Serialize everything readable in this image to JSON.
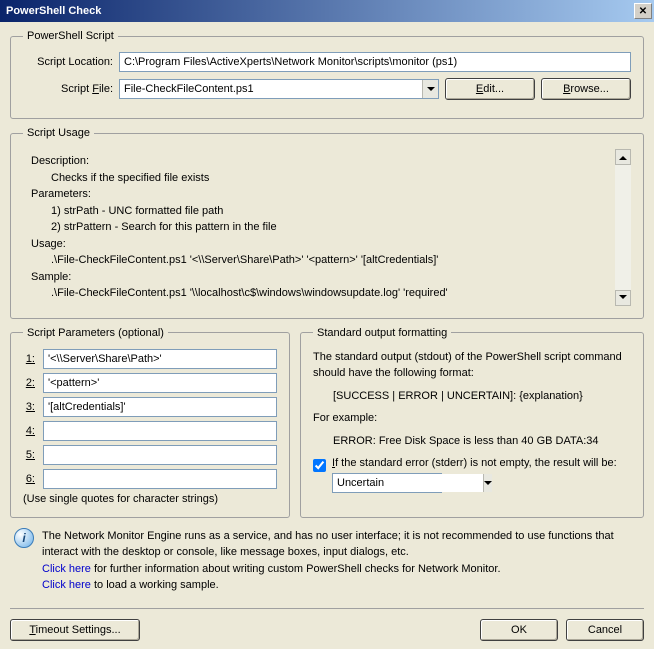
{
  "title": "PowerShell Check",
  "scriptGroup": {
    "legend": "PowerShell Script",
    "locationLabel": "Script Location:",
    "locationValue": "C:\\Program Files\\ActiveXperts\\Network Monitor\\scripts\\monitor (ps1)",
    "fileLabel": "Script File:",
    "fileValue": "File-CheckFileContent.ps1",
    "editBtn": "Edit...",
    "browseBtn": "Browse..."
  },
  "usageGroup": {
    "legend": "Script Usage",
    "descLabel": "Description:",
    "descText": "Checks if the specified file exists",
    "paramsLabel": "Parameters:",
    "param1": "1) strPath - UNC formatted file path",
    "param2": "2) strPattern - Search for this pattern in the file",
    "usageLabel": "Usage:",
    "usageText": ".\\File-CheckFileContent.ps1 '<\\\\Server\\Share\\Path>' '<pattern>' '[altCredentials]'",
    "sampleLabel": "Sample:",
    "sampleText": ".\\File-CheckFileContent.ps1 '\\\\localhost\\c$\\windows\\windowsupdate.log' 'required'"
  },
  "paramsGroup": {
    "legend": "Script Parameters (optional)",
    "labels": [
      "1:",
      "2:",
      "3:",
      "4:",
      "5:",
      "6:"
    ],
    "values": [
      "'<\\\\Server\\Share\\Path>'",
      "'<pattern>'",
      "'[altCredentials]'",
      "",
      "",
      ""
    ],
    "note": "(Use single quotes for character strings)"
  },
  "stdoutGroup": {
    "legend": "Standard output formatting",
    "line1": "The standard output (stdout) of the PowerShell script command should have the following format:",
    "line2": "[SUCCESS | ERROR | UNCERTAIN]: {explanation}",
    "line3": "For example:",
    "line4": "ERROR: Free Disk Space is less than 40 GB DATA:34",
    "checkLabel": "If the standard error (stderr) is not empty, the result will be:",
    "resultValue": "Uncertain"
  },
  "info": {
    "line1": "The Network Monitor Engine runs as a service, and has no user interface; it is not recommended to use functions that interact with the desktop or console, like message boxes, input dialogs, etc.",
    "link1pre": "Click here",
    "link1post": " for further information about writing custom PowerShell checks for Network Monitor.",
    "link2pre": "Click here",
    "link2post": " to load a working sample."
  },
  "buttons": {
    "timeout": "Timeout Settings...",
    "ok": "OK",
    "cancel": "Cancel"
  }
}
